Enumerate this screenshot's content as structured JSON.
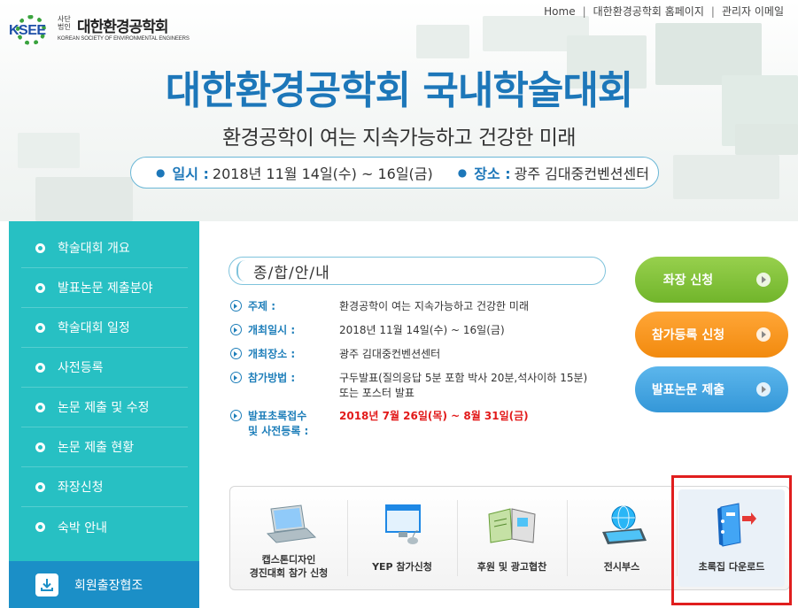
{
  "header": {
    "logo": {
      "mark": "KSEE",
      "small": "사단법인",
      "name": "대한환경공학회",
      "english": "KOREAN SOCIETY OF ENVIRONMENTAL ENGINEERS"
    },
    "topnav": [
      "Home",
      "대한환경공학회 홈페이지",
      "관리자 이메일"
    ],
    "title": "대한환경공학회 국내학술대회",
    "subtitle": "환경공학이 여는 지속가능하고 건강한 미래",
    "date_label": "일시 :",
    "date_value": "2018년 11월 14일(수) ~ 16일(금)",
    "venue_label": "장소 :",
    "venue_value": "광주 김대중컨벤션센터"
  },
  "sidebar": {
    "items": [
      {
        "label": "학술대회 개요"
      },
      {
        "label": "발표논문 제출분야"
      },
      {
        "label": "학술대회 일정"
      },
      {
        "label": "사전등록"
      },
      {
        "label": "논문 제출 및 수정"
      },
      {
        "label": "논문 제출 현황"
      },
      {
        "label": "좌장신청"
      },
      {
        "label": "숙박 안내"
      }
    ],
    "footer": "회원출장협조"
  },
  "overview": {
    "title": "종/합/안/내",
    "rows": [
      {
        "key": "주제 :",
        "value": "환경공학이 여는 지속가능하고 건강한 미래"
      },
      {
        "key": "개최일시 :",
        "value": "2018년 11월 14일(수) ~ 16일(금)"
      },
      {
        "key": "개최장소 :",
        "value": "광주 김대중컨벤션센터"
      },
      {
        "key": "참가방법 :",
        "value": "구두발표(질의응답 5분 포함 박사 20분,석사이하 15분)",
        "value2": "또는 포스터 발표"
      },
      {
        "key": "발표초록접수",
        "key2": "및 사전등록 :",
        "value": "2018년 7월 26일(목) ~ 8월 31일(금)"
      }
    ]
  },
  "actions": {
    "chair": "좌장 신청",
    "register": "참가등록 신청",
    "submit": "발표논문 제출"
  },
  "quicklinks": [
    {
      "line1": "캡스톤디자인",
      "line2": "경진대회 참가 신청",
      "icon": "laptop-icon"
    },
    {
      "line1": "YEP 참가신청",
      "line2": "",
      "icon": "monitor-icon"
    },
    {
      "line1": "후원 및 광고협찬",
      "line2": "",
      "icon": "magazine-icon"
    },
    {
      "line1": "전시부스",
      "line2": "",
      "icon": "globe-tablet-icon"
    },
    {
      "line1": "초록집 다운로드",
      "line2": "",
      "icon": "binder-icon"
    }
  ],
  "colors": {
    "brand_blue": "#1d77b9",
    "sidebar": "#27c0c3",
    "sidebar_footer": "#1b8fc7",
    "green": "#7cbf35",
    "orange": "#f7931e",
    "blue_button": "#43a4e0",
    "highlight": "#e01e1e",
    "date_red": "#e21a1a"
  }
}
